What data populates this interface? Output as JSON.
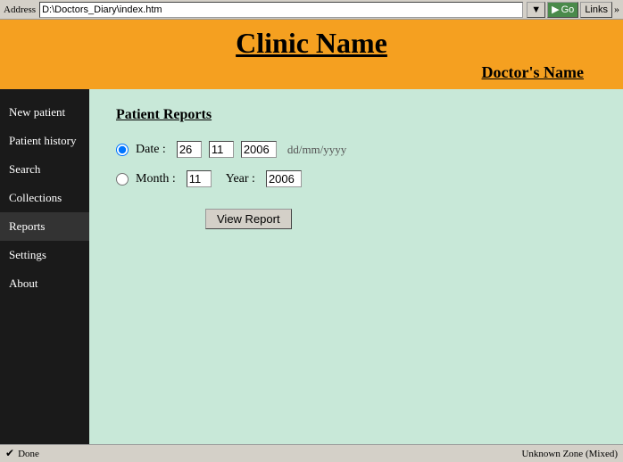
{
  "browser": {
    "address_label": "Address",
    "address_value": "D:\\Doctors_Diary\\index.htm",
    "go_label": "Go",
    "links_label": "Links"
  },
  "header": {
    "clinic_name": "Clinic Name",
    "doctor_name": "Doctor's Name"
  },
  "sidebar": {
    "items": [
      {
        "id": "new-patient",
        "label": "New patient"
      },
      {
        "id": "patient-history",
        "label": "Patient history"
      },
      {
        "id": "search",
        "label": "Search"
      },
      {
        "id": "collections",
        "label": "Collections"
      },
      {
        "id": "reports",
        "label": "Reports"
      },
      {
        "id": "settings",
        "label": "Settings"
      },
      {
        "id": "about",
        "label": "About"
      }
    ]
  },
  "main": {
    "page_title": "Patient Reports",
    "date_label": "Date :",
    "day_value": "26",
    "month_value": "11",
    "year_value": "2006",
    "date_hint": "dd/mm/yyyy",
    "month_label": "Month :",
    "month_field_value": "11",
    "year_label": "Year :",
    "year_field_value": "2006",
    "view_report_btn": "View Report"
  },
  "status": {
    "left": "Done",
    "right": "Unknown Zone (Mixed)"
  }
}
